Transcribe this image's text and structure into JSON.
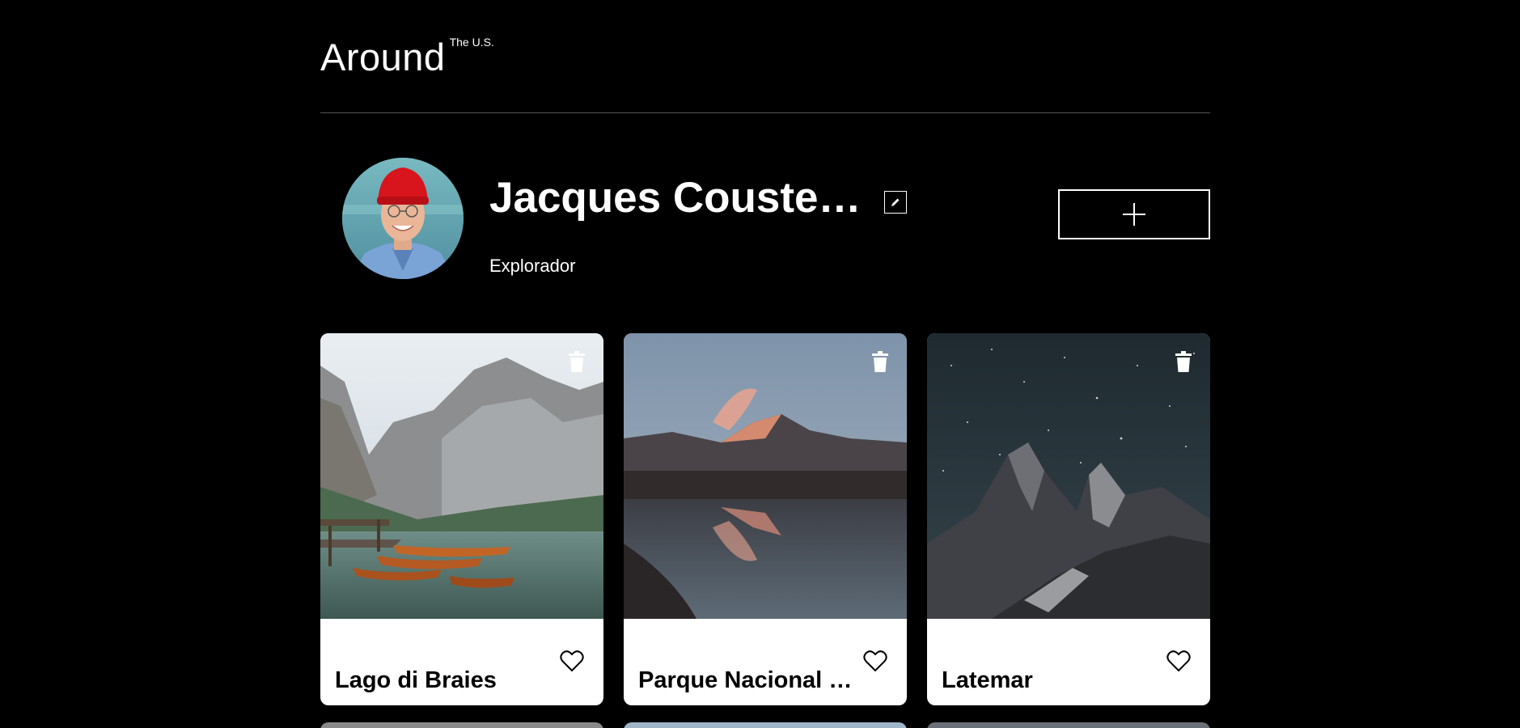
{
  "header": {
    "logo_main": "Around",
    "logo_sup": "The U.S."
  },
  "profile": {
    "name": "Jacques Cousteau",
    "about": "Explorador",
    "edit_icon": "pencil-icon",
    "add_icon": "plus-icon"
  },
  "cards": [
    {
      "title": "Lago di Braies",
      "image": "mountain-lake-boats",
      "liked": false
    },
    {
      "title": "Parque Nacional de la Vanoise",
      "image": "mountain-reflection-sunset",
      "liked": false
    },
    {
      "title": "Latemar",
      "image": "night-sky-mountains",
      "liked": false
    }
  ],
  "colors": {
    "background": "#000000",
    "card": "#ffffff",
    "text": "#ffffff",
    "divider": "#545454"
  }
}
